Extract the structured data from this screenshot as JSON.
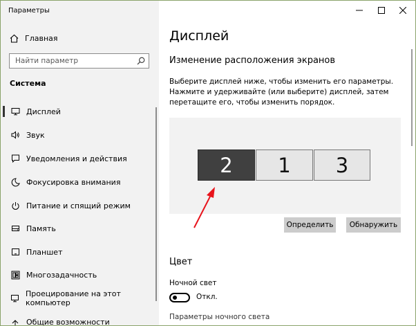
{
  "app": {
    "title": "Параметры"
  },
  "sidebar": {
    "home_label": "Главная",
    "search_placeholder": "Найти параметр",
    "section_label": "Система",
    "items": [
      {
        "label": "Дисплей",
        "icon": "monitor-icon",
        "active": true
      },
      {
        "label": "Звук",
        "icon": "speaker-icon"
      },
      {
        "label": "Уведомления и действия",
        "icon": "notification-icon"
      },
      {
        "label": "Фокусировка внимания",
        "icon": "moon-icon"
      },
      {
        "label": "Питание и спящий режим",
        "icon": "power-icon"
      },
      {
        "label": "Память",
        "icon": "storage-icon"
      },
      {
        "label": "Планшет",
        "icon": "tablet-icon"
      },
      {
        "label": "Многозадачность",
        "icon": "multitasking-icon"
      },
      {
        "label": "Проецирование на этот компьютер",
        "icon": "projection-icon"
      },
      {
        "label": "Общие возможности",
        "icon": "shared-icon"
      }
    ]
  },
  "main": {
    "title": "Дисплей",
    "arrange_heading": "Изменение расположения экранов",
    "arrange_description": "Выберите дисплей ниже, чтобы изменить его параметры. Нажмите и удерживайте (или выберите) дисплей, затем перетащите его, чтобы изменить порядок.",
    "monitors": [
      {
        "label": "2",
        "selected": true
      },
      {
        "label": "1",
        "selected": false
      },
      {
        "label": "3",
        "selected": false
      }
    ],
    "identify_button": "Определить",
    "detect_button": "Обнаружить",
    "color_heading": "Цвет",
    "night_light_label": "Ночной свет",
    "night_light_state": "Откл.",
    "night_light_settings_link": "Параметры ночного света"
  },
  "colors": {
    "annotation_arrow": "#e8141c",
    "selected_monitor": "#404040",
    "sidebar_bg": "#f2f2f2"
  }
}
